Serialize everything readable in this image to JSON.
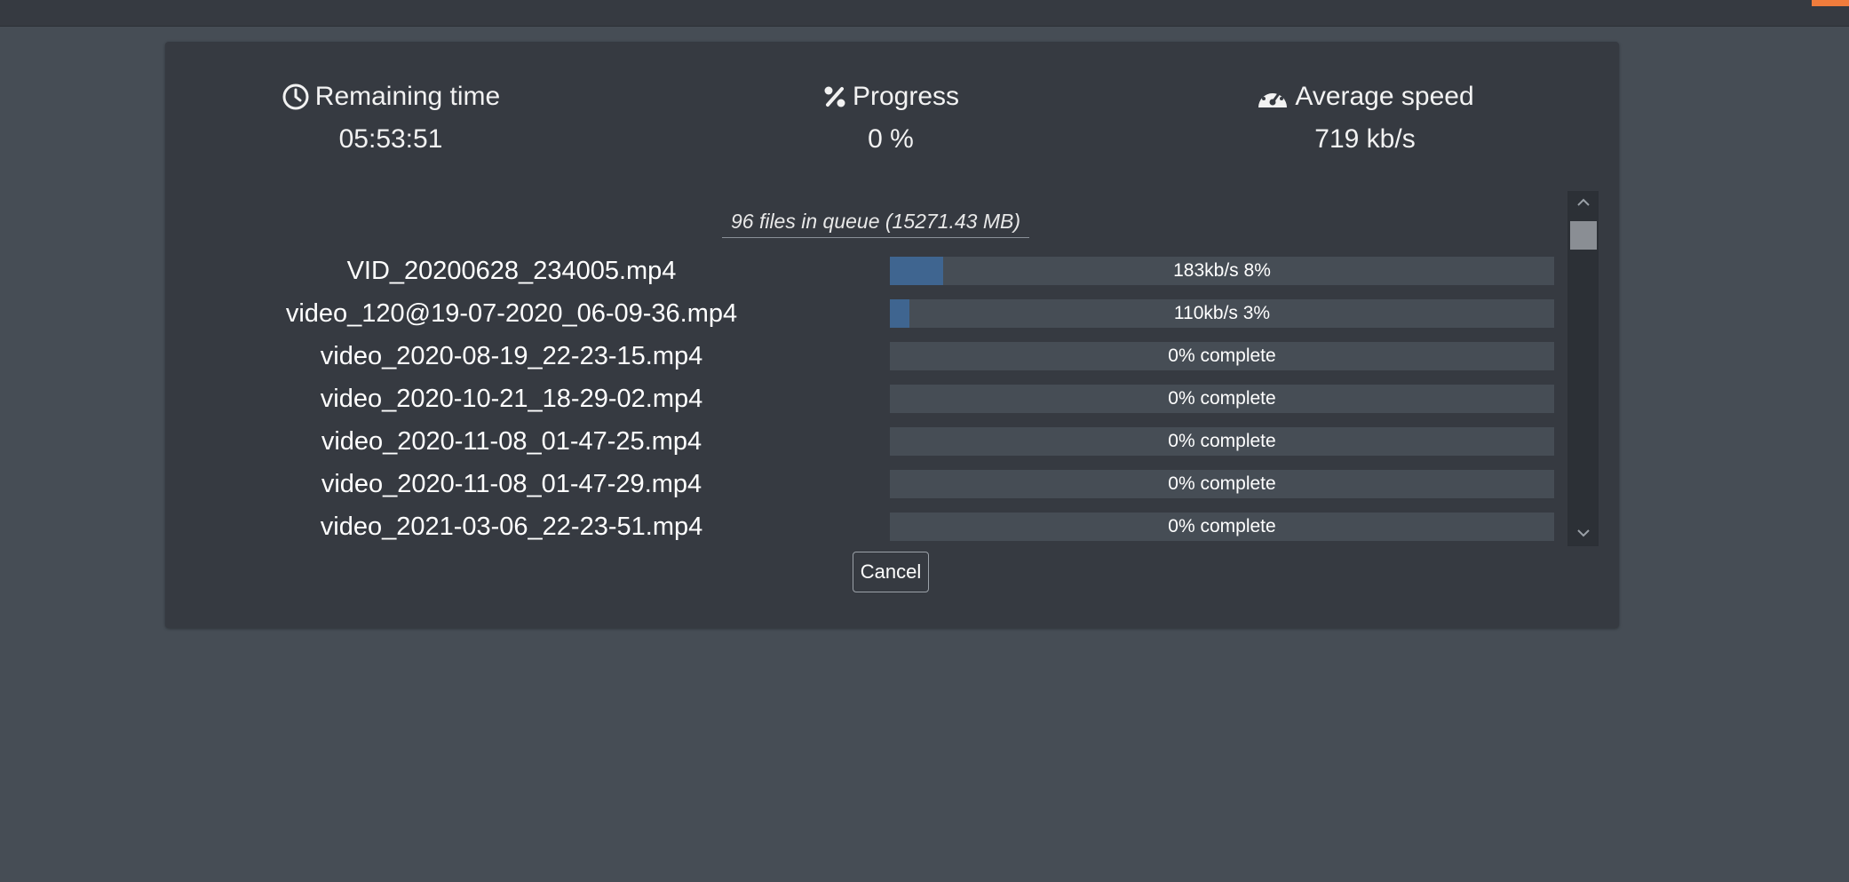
{
  "colors": {
    "accent": "#f07c3c",
    "progress_fill": "#3f6590",
    "panel_bg": "#363a41",
    "page_bg": "#464d55"
  },
  "stats": {
    "remaining_time": {
      "label": "Remaining time",
      "value": "05:53:51",
      "icon": "clock-icon"
    },
    "progress": {
      "label": "Progress",
      "value": "0 %",
      "icon": "percent-icon"
    },
    "average_speed": {
      "label": "Average speed",
      "value": "719 kb/s",
      "icon": "speedometer-icon"
    }
  },
  "queue": {
    "summary": "96 files in queue (15271.43 MB)",
    "files": [
      {
        "name": "VID_20200628_234005.mp4",
        "status": "183kb/s 8%",
        "progress": 0.08
      },
      {
        "name": "video_120@19-07-2020_06-09-36.mp4",
        "status": "110kb/s 3%",
        "progress": 0.03
      },
      {
        "name": "video_2020-08-19_22-23-15.mp4",
        "status": "0% complete",
        "progress": 0
      },
      {
        "name": "video_2020-10-21_18-29-02.mp4",
        "status": "0% complete",
        "progress": 0
      },
      {
        "name": "video_2020-11-08_01-47-25.mp4",
        "status": "0% complete",
        "progress": 0
      },
      {
        "name": "video_2020-11-08_01-47-29.mp4",
        "status": "0% complete",
        "progress": 0
      },
      {
        "name": "video_2021-03-06_22-23-51.mp4",
        "status": "0% complete",
        "progress": 0
      }
    ]
  },
  "actions": {
    "cancel_label": "Cancel"
  }
}
